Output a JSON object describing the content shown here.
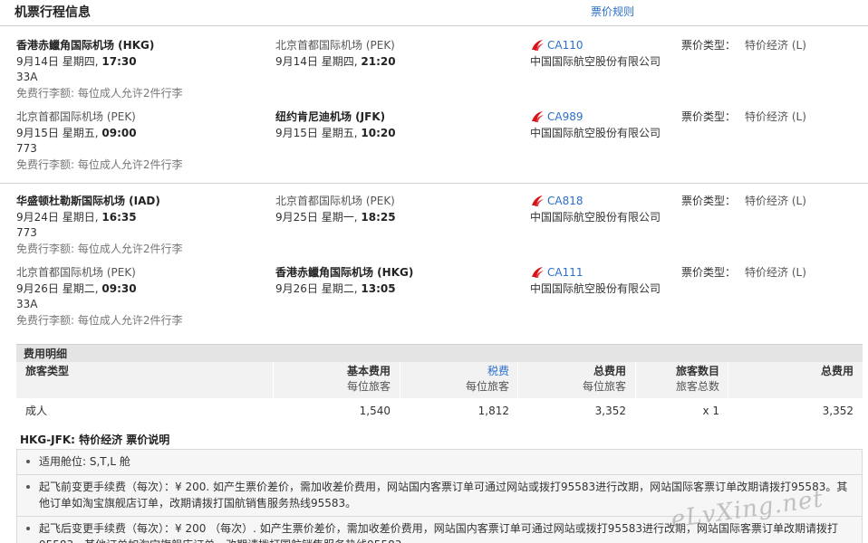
{
  "header": {
    "title": "机票行程信息",
    "fare_rules_link": "票价规则"
  },
  "segments": [
    {
      "dep_airport": "香港赤鱲角国际机场 (HKG)",
      "dep_date": "9月14日 星期四,",
      "dep_time": "17:30",
      "aircraft": "33A",
      "baggage": "免费行李额: 每位成人允许2件行李",
      "arr_airport": "北京首都国际机场 (PEK)",
      "arr_date": "9月14日 星期四,",
      "arr_time": "21:20",
      "flight_no": "CA110",
      "airline": "中国国际航空股份有限公司",
      "fare_type_label": "票价类型：",
      "fare_type": "特价经济 (L)"
    },
    {
      "dep_airport": "北京首都国际机场 (PEK)",
      "dep_date": "9月15日 星期五,",
      "dep_time": "09:00",
      "aircraft": "773",
      "baggage": "免费行李额: 每位成人允许2件行李",
      "arr_airport": "纽约肯尼迪机场 (JFK)",
      "arr_date": "9月15日 星期五,",
      "arr_time": "10:20",
      "flight_no": "CA989",
      "airline": "中国国际航空股份有限公司",
      "fare_type_label": "票价类型：",
      "fare_type": "特价经济 (L)"
    },
    {
      "dep_airport": "华盛顿杜勒斯国际机场 (IAD)",
      "dep_date": "9月24日 星期日,",
      "dep_time": "16:35",
      "aircraft": "773",
      "baggage": "免费行李额: 每位成人允许2件行李",
      "arr_airport": "北京首都国际机场 (PEK)",
      "arr_date": "9月25日 星期一,",
      "arr_time": "18:25",
      "flight_no": "CA818",
      "airline": "中国国际航空股份有限公司",
      "fare_type_label": "票价类型：",
      "fare_type": "特价经济 (L)"
    },
    {
      "dep_airport": "北京首都国际机场 (PEK)",
      "dep_date": "9月26日 星期二,",
      "dep_time": "09:30",
      "aircraft": "33A",
      "baggage": "免费行李额: 每位成人允许2件行李",
      "arr_airport": "香港赤鱲角国际机场 (HKG)",
      "arr_date": "9月26日 星期二,",
      "arr_time": "13:05",
      "flight_no": "CA111",
      "airline": "中国国际航空股份有限公司",
      "fare_type_label": "票价类型：",
      "fare_type": "特价经济 (L)"
    }
  ],
  "fees": {
    "title": "费用明细",
    "columns": {
      "passenger_type": "旅客类型",
      "base_fare": "基本费用",
      "base_fare_sub": "每位旅客",
      "tax": "税费",
      "tax_sub": "每位旅客",
      "total_fare": "总费用",
      "total_fare_sub": "每位旅客",
      "pax_count": "旅客数目",
      "pax_count_sub": "旅客总数",
      "grand_total": "总费用"
    },
    "row": {
      "passenger_type": "成人",
      "base_fare": "1,540",
      "tax": "1,812",
      "total_fare": "3,352",
      "pax_count": "x 1",
      "grand_total": "3,352"
    }
  },
  "notes": {
    "title_route": "HKG-JFK:",
    "title_text": "特价经济 票价说明",
    "items": [
      "适用舱位: S,T,L 舱",
      "起飞前变更手续费（每次）：¥ 200. 如产生票价差价，需加收差价费用，网站国内客票订单可通过网站或拨打95583进行改期，网站国际客票订单改期请拨打95583。其他订单如淘宝旗舰店订单，改期请拨打国航销售服务热线95583。",
      "起飞后变更手续费（每次）：¥ 200 （每次）. 如产生票价差价，需加收差价费用，网站国内客票订单可通过网站或拨打95583进行改期，网站国际客票订单改期请拨打95583。其他订单如淘宝旗舰店订单，改期请拨打国航销售服务热线95583。"
    ]
  },
  "watermark": "eLvXing.net",
  "colors": {
    "link": "#2a6fc9",
    "airline_logo": "#d7141a",
    "fee_header_bg": "#e4e4e4"
  }
}
